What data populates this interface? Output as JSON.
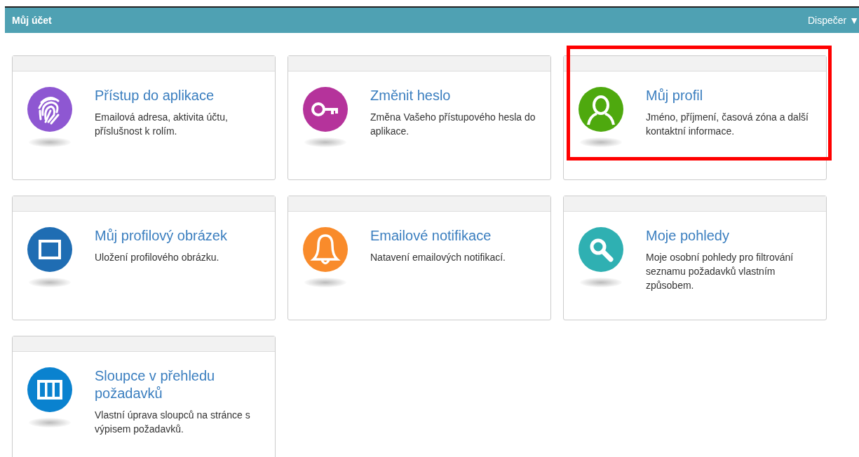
{
  "header": {
    "title": "Můj účet",
    "user_menu": "Dispečer ▼"
  },
  "cards": [
    {
      "kind": "fingerprint",
      "color": "#8e57d2",
      "title": "Přístup do aplikace",
      "description": "Emailová adresa, aktivita účtu, příslušnost k rolím.",
      "highlighted": false
    },
    {
      "kind": "key",
      "color": "#b5339b",
      "title": "Změnit heslo",
      "description": "Změna Vašeho přístupového hesla do aplikace.",
      "highlighted": false
    },
    {
      "kind": "person",
      "color": "#4ea90e",
      "title": "Můj profil",
      "description": "Jméno, příjmení, časová zóna a další kontaktní informace.",
      "highlighted": true
    },
    {
      "kind": "frame",
      "color": "#1f6db3",
      "title": "Můj profilový obrázek",
      "description": "Uložení profilového obrázku.",
      "highlighted": false
    },
    {
      "kind": "bell",
      "color": "#f98b2b",
      "title": "Emailové notifikace",
      "description": "Natavení emailových notifikací.",
      "highlighted": false
    },
    {
      "kind": "search",
      "color": "#2fb0b2",
      "title": "Moje pohledy",
      "description": "Moje osobní pohledy pro filtrování seznamu požadavků vlastním způsobem.",
      "highlighted": false
    },
    {
      "kind": "columns",
      "color": "#0a82cf",
      "title": "Sloupce v přehledu požadavků",
      "description": "Vlastní úprava sloupců na stránce s výpisem požadavků.",
      "highlighted": false
    }
  ]
}
